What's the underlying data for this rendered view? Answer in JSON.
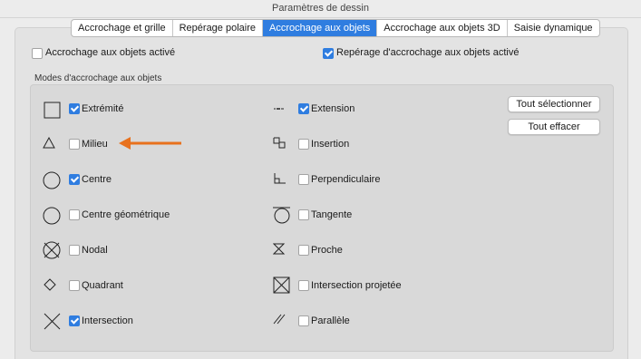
{
  "window": {
    "title": "Paramètres de dessin"
  },
  "tabs": [
    {
      "label": "Accrochage et grille",
      "active": false
    },
    {
      "label": "Repérage polaire",
      "active": false
    },
    {
      "label": "Accrochage aux objets",
      "active": true
    },
    {
      "label": "Accrochage aux objets 3D",
      "active": false
    },
    {
      "label": "Saisie dynamique",
      "active": false
    }
  ],
  "top_options": {
    "osnap_on": {
      "label": "Accrochage aux objets activé",
      "checked": false
    },
    "tracking_on": {
      "label": "Repérage d'accrochage aux objets activé",
      "checked": true
    }
  },
  "modes": {
    "group_title": "Modes d'accrochage aux objets",
    "left": [
      {
        "label": "Extrémité",
        "checked": true,
        "icon": "square-endpoint-icon"
      },
      {
        "label": "Milieu",
        "checked": false,
        "icon": "triangle-midpoint-icon"
      },
      {
        "label": "Centre",
        "checked": true,
        "icon": "circle-center-icon"
      },
      {
        "label": "Centre géométrique",
        "checked": false,
        "icon": "circle-geometric-center-icon"
      },
      {
        "label": "Nodal",
        "checked": false,
        "icon": "circle-x-node-icon"
      },
      {
        "label": "Quadrant",
        "checked": false,
        "icon": "diamond-quadrant-icon"
      },
      {
        "label": "Intersection",
        "checked": true,
        "icon": "x-intersection-icon"
      }
    ],
    "right": [
      {
        "label": "Extension",
        "checked": true,
        "icon": "dashes-extension-icon"
      },
      {
        "label": "Insertion",
        "checked": false,
        "icon": "squares-insertion-icon"
      },
      {
        "label": "Perpendiculaire",
        "checked": false,
        "icon": "perpendicular-icon"
      },
      {
        "label": "Tangente",
        "checked": false,
        "icon": "circle-tangent-icon"
      },
      {
        "label": "Proche",
        "checked": false,
        "icon": "hourglass-nearest-icon"
      },
      {
        "label": "Intersection projetée",
        "checked": false,
        "icon": "square-x-apparent-intersection-icon"
      },
      {
        "label": "Parallèle",
        "checked": false,
        "icon": "parallel-lines-icon"
      }
    ]
  },
  "buttons": {
    "select_all": "Tout sélectionner",
    "clear_all": "Tout effacer"
  },
  "annotation": {
    "arrow_color": "#e8711d"
  },
  "colors": {
    "accent": "#2f7de0"
  }
}
